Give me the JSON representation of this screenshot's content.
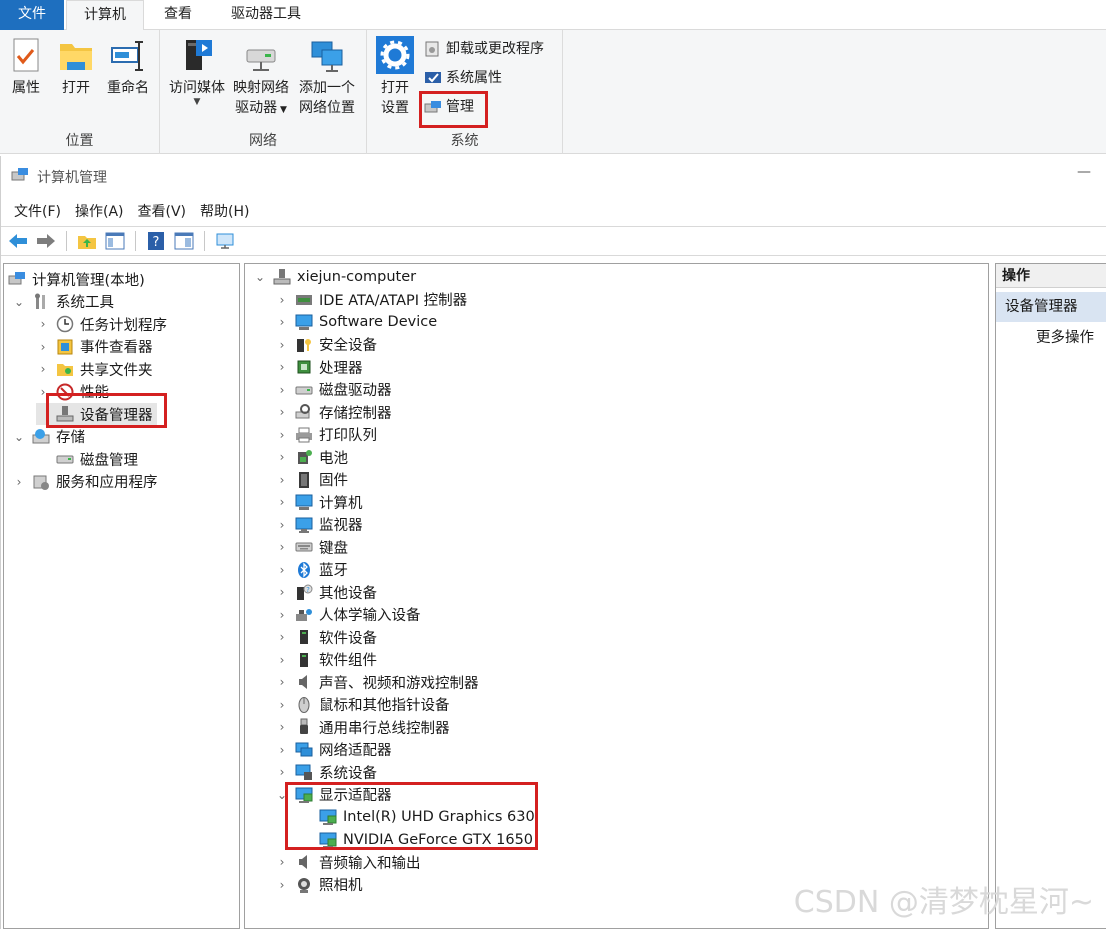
{
  "ribbon": {
    "tabs": [
      "文件",
      "计算机",
      "查看",
      "驱动器工具"
    ],
    "groups": [
      {
        "label": "位置",
        "buttons": [
          "属性",
          "打开",
          "重命名"
        ]
      },
      {
        "label": "网络",
        "buttons": [
          "访问媒体",
          "映射网络",
          "驱动器",
          "添加一个",
          "网络位置"
        ]
      },
      {
        "label": "系统",
        "buttons": [
          "打开",
          "设置"
        ],
        "small_buttons": [
          "卸载或更改程序",
          "系统属性",
          "管理"
        ]
      }
    ]
  },
  "window": {
    "title": "计算机管理",
    "minimize_glyph": "—",
    "menus": [
      "文件(F)",
      "操作(A)",
      "查看(V)",
      "帮助(H)"
    ]
  },
  "left_tree": [
    {
      "label": "计算机管理(本地)",
      "level": 0,
      "chevron": "",
      "icon": "computer-management-icon"
    },
    {
      "label": "系统工具",
      "level": 1,
      "chevron": "⌄",
      "icon": "tools-icon"
    },
    {
      "label": "任务计划程序",
      "level": 2,
      "chevron": "›",
      "icon": "clock-icon"
    },
    {
      "label": "事件查看器",
      "level": 2,
      "chevron": "›",
      "icon": "event-viewer-icon"
    },
    {
      "label": "共享文件夹",
      "level": 2,
      "chevron": "›",
      "icon": "shared-folder-icon"
    },
    {
      "label": "性能",
      "level": 2,
      "chevron": "›",
      "icon": "performance-icon"
    },
    {
      "label": "设备管理器",
      "level": 2,
      "chevron": "",
      "icon": "device-manager-icon",
      "selected": true
    },
    {
      "label": "存储",
      "level": 1,
      "chevron": "⌄",
      "icon": "storage-icon"
    },
    {
      "label": "磁盘管理",
      "level": 2,
      "chevron": "",
      "icon": "disk-icon"
    },
    {
      "label": "服务和应用程序",
      "level": 1,
      "chevron": "›",
      "icon": "services-icon"
    }
  ],
  "device_tree": {
    "root": "xiejun-computer",
    "categories": [
      "IDE ATA/ATAPI 控制器",
      "Software Device",
      "安全设备",
      "处理器",
      "磁盘驱动器",
      "存储控制器",
      "打印队列",
      "电池",
      "固件",
      "计算机",
      "监视器",
      "键盘",
      "蓝牙",
      "其他设备",
      "人体学输入设备",
      "软件设备",
      "软件组件",
      "声音、视频和游戏控制器",
      "鼠标和其他指针设备",
      "通用串行总线控制器",
      "网络适配器",
      "系统设备",
      "显示适配器"
    ],
    "display_adapters": [
      "Intel(R) UHD Graphics 630",
      "NVIDIA GeForce GTX 1650"
    ],
    "after": [
      "音频输入和输出",
      "照相机"
    ]
  },
  "actions": {
    "header": "操作",
    "selected": "设备管理器",
    "more": "更多操作"
  },
  "watermark": "CSDN @清梦枕星河~",
  "colors": {
    "accent": "#1e6fbf",
    "highlight": "#d42020",
    "selected_action": "#d9e4f2"
  }
}
